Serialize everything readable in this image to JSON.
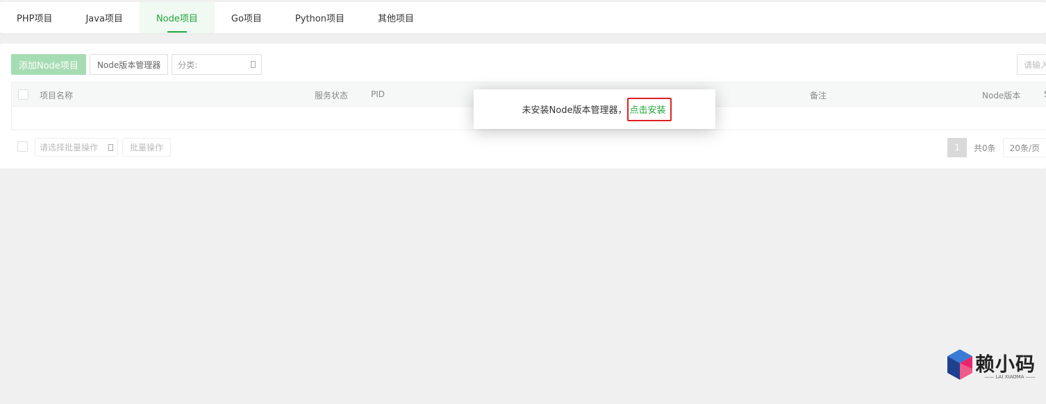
{
  "tabs": [
    {
      "label": "PHP项目"
    },
    {
      "label": "Java项目"
    },
    {
      "label": "Node项目",
      "active": true
    },
    {
      "label": "Go项目"
    },
    {
      "label": "Python项目"
    },
    {
      "label": "其他项目"
    }
  ],
  "toolbar": {
    "add_label": "添加Node项目",
    "version_manager_label": "Node版本管理器",
    "category_label": "分类:",
    "search_placeholder": "请输入"
  },
  "table": {
    "columns": [
      "项目名称",
      "服务状态",
      "PID",
      "备注",
      "Node版本",
      "S"
    ]
  },
  "footer": {
    "batch_placeholder": "请选择批量操作",
    "batch_button": "批量操作",
    "page_current": "1",
    "total": "共0条",
    "per_page": "20条/页"
  },
  "modal": {
    "message": "未安装Node版本管理器，",
    "link": "点击安装"
  },
  "watermark": {
    "title": "赖小码",
    "subtitle": "—— LAI XIAOMA ——"
  },
  "colors": {
    "accent": "#20a53a",
    "highlight": "#e02020"
  }
}
